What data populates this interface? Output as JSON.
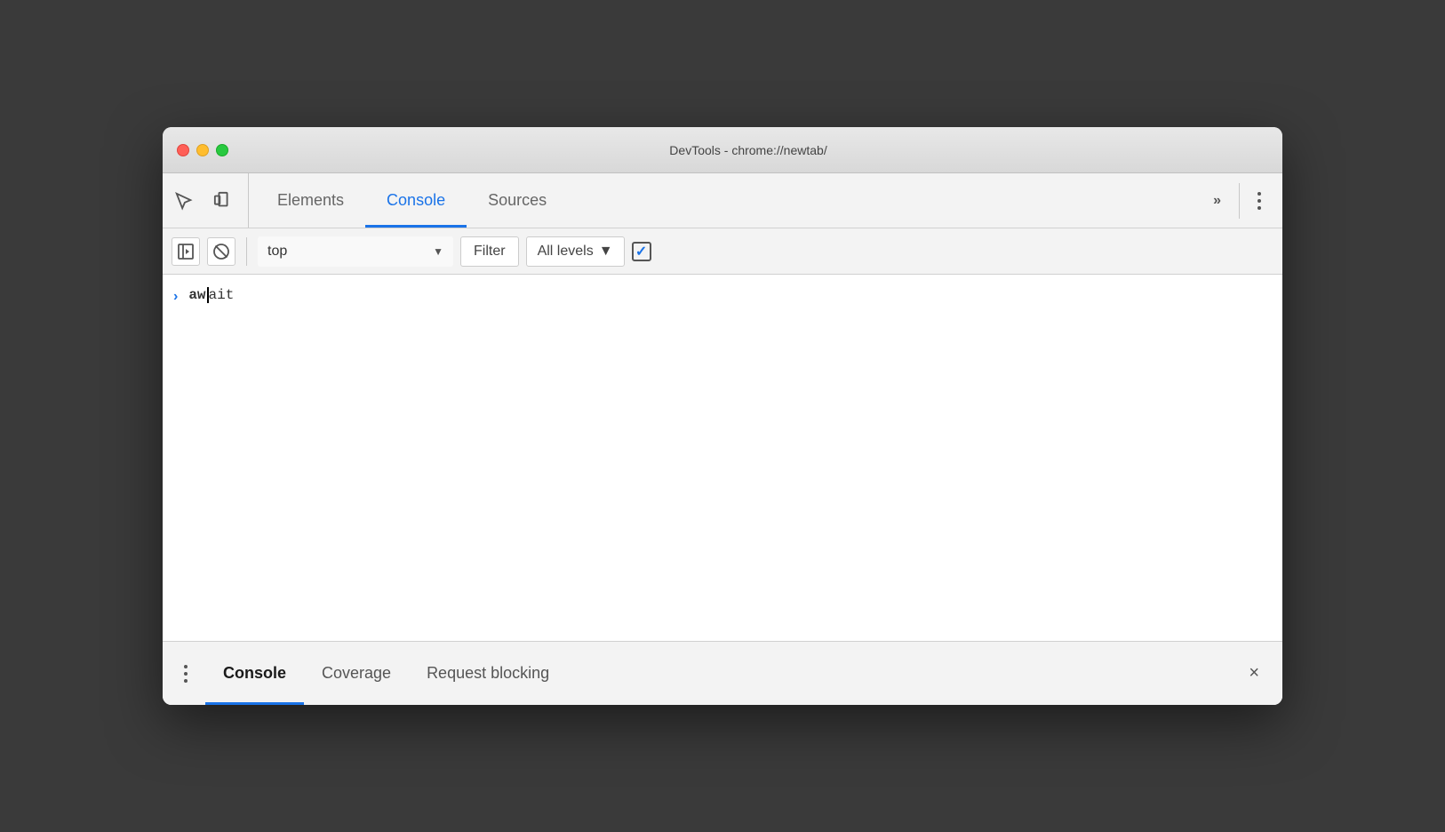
{
  "window": {
    "title": "DevTools - chrome://newtab/"
  },
  "traffic_lights": {
    "close_label": "close",
    "minimize_label": "minimize",
    "maximize_label": "maximize"
  },
  "top_toolbar": {
    "inspect_icon": "inspect-element-icon",
    "device_icon": "device-toolbar-icon",
    "tabs": [
      {
        "label": "Elements",
        "active": false
      },
      {
        "label": "Console",
        "active": true
      },
      {
        "label": "Sources",
        "active": false
      }
    ],
    "more_label": "»",
    "kebab_label": "⋮"
  },
  "console_toolbar": {
    "sidebar_icon": "sidebar-icon",
    "clear_icon": "clear-icon",
    "context_label": "top",
    "filter_label": "Filter",
    "levels_label": "All levels",
    "checkbox_checked": true
  },
  "console_content": {
    "entries": [
      {
        "arrow": ">",
        "bold_text": "aw",
        "normal_text": "ait"
      }
    ]
  },
  "bottom_drawer": {
    "tabs": [
      {
        "label": "Console",
        "active": true
      },
      {
        "label": "Coverage",
        "active": false
      },
      {
        "label": "Request blocking",
        "active": false
      }
    ],
    "close_label": "×"
  }
}
